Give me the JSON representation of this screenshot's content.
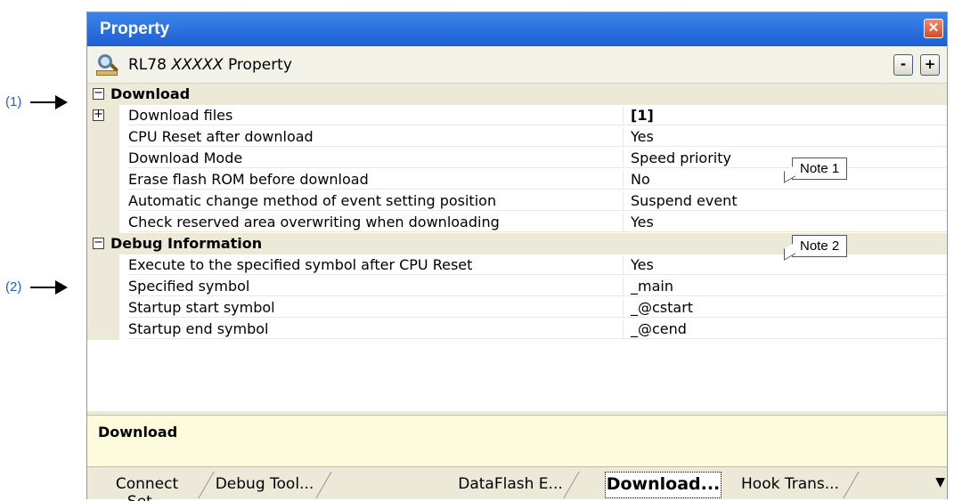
{
  "callouts": [
    {
      "label": "(1)"
    },
    {
      "label": "(2)"
    }
  ],
  "window": {
    "title": "Property",
    "close_icon": "close-icon",
    "header": {
      "prefix": "RL78",
      "model": "XXXXX",
      "suffix": "Property",
      "icon": "property-icon",
      "collapse_label": "-",
      "expand_label": "+"
    }
  },
  "grid": {
    "categories": [
      {
        "name": "Download",
        "expander": "−",
        "rows": [
          {
            "name": "Download files",
            "value": "[1]",
            "expander": "+"
          },
          {
            "name": "CPU Reset after download",
            "value": "Yes"
          },
          {
            "name": "Download Mode",
            "value": "Speed priority"
          },
          {
            "name": "Erase flash ROM before download",
            "value": "No"
          },
          {
            "name": "Automatic change method of event setting position",
            "value": "Suspend event"
          },
          {
            "name": "Check reserved area overwriting when downloading",
            "value": "Yes"
          }
        ]
      },
      {
        "name": "Debug Information",
        "expander": "−",
        "rows": [
          {
            "name": "Execute to the specified symbol after CPU Reset",
            "value": "Yes"
          },
          {
            "name": "Specified symbol",
            "value": "_main"
          },
          {
            "name": "Startup start symbol",
            "value": "_@cstart"
          },
          {
            "name": "Startup end symbol",
            "value": "_@cend"
          }
        ]
      }
    ],
    "notes": [
      {
        "label": "Note 1"
      },
      {
        "label": "Note 2"
      }
    ]
  },
  "description": {
    "text": "Download"
  },
  "tabs": [
    {
      "label": "Connect Set..."
    },
    {
      "label": "Debug Tool..."
    },
    {
      "label": "DataFlash E..."
    },
    {
      "label": "Download...",
      "active": true
    },
    {
      "label": "Hook Trans..."
    }
  ],
  "tab_menu": "▼"
}
